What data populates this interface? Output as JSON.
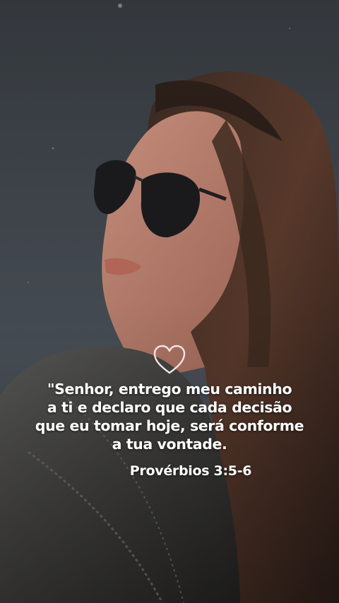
{
  "quote": {
    "text": "\"Senhor, entrego meu caminho\na ti e declaro que cada decisão\nque eu tomar hoje, será conforme\na tua vontade.",
    "reference": "Provérbios 3:5-6"
  },
  "icons": {
    "heart": "heart-outline-icon"
  },
  "colors": {
    "sky": "#3a4046",
    "text": "#ffffff",
    "heart_stroke": "#f2e4e4"
  }
}
